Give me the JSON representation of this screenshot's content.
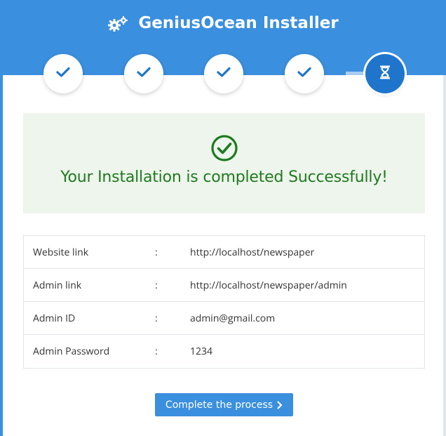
{
  "app": {
    "title": "GeniusOcean Installer",
    "accent_color": "#3a8fde"
  },
  "steps": [
    {
      "status": "done",
      "icon": "check-icon"
    },
    {
      "status": "done",
      "icon": "check-icon"
    },
    {
      "status": "done",
      "icon": "check-icon"
    },
    {
      "status": "done",
      "icon": "check-icon"
    },
    {
      "status": "current",
      "icon": "hourglass-icon"
    }
  ],
  "progress": 0.875,
  "success": {
    "message": "Your Installation is completed Successfully!",
    "icon": "check-circle-icon",
    "color": "#1f7a1f"
  },
  "details": [
    {
      "label": "Website link",
      "separator": ":",
      "value": "http://localhost/newspaper"
    },
    {
      "label": "Admin link",
      "separator": ":",
      "value": "http://localhost/newspaper/admin"
    },
    {
      "label": "Admin ID",
      "separator": ":",
      "value": "admin@gmail.com"
    },
    {
      "label": "Admin Password",
      "separator": ":",
      "value": "1234"
    }
  ],
  "complete_button": {
    "label": "Complete the process",
    "icon": "chevron-right-icon"
  }
}
